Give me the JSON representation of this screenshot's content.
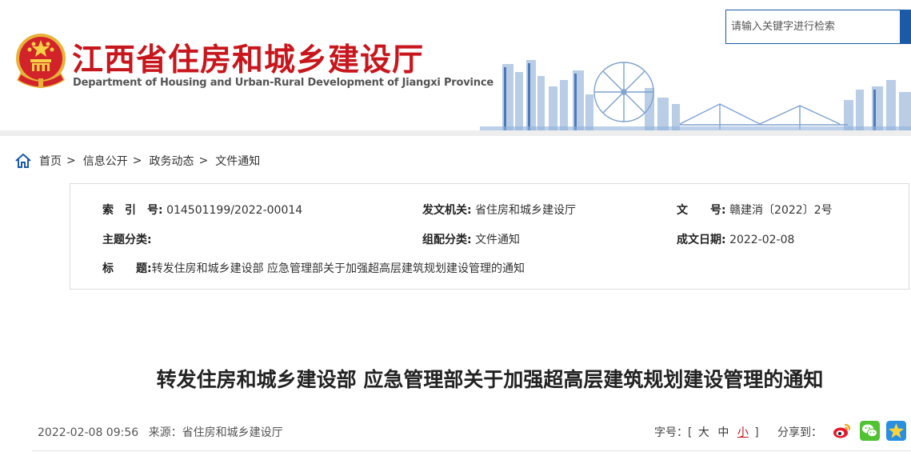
{
  "header": {
    "site_title": "江西省住房和城乡建设厅",
    "site_subtitle": "Department of Housing and Urban-Rural Development of Jiangxi Province",
    "search_placeholder": "请输入关键字进行检索",
    "accent_color": "#c8161d",
    "search_color": "#1a5aa8",
    "emblem_icon": "national-emblem-icon",
    "search_icon": "search-icon"
  },
  "breadcrumb": {
    "home_icon": "home-icon",
    "items": [
      "首页",
      "信息公开",
      "政务动态",
      "文件通知"
    ],
    "separator": ">"
  },
  "meta": {
    "index": {
      "label": "索　引　号:",
      "value": "014501199/2022-00014"
    },
    "issuer": {
      "label": "发文机关:",
      "value": "省住房和城乡建设厅"
    },
    "doc_no": {
      "label": "文　　号:",
      "value": "赣建消〔2022〕2号"
    },
    "topic": {
      "label": "主题分类:",
      "value": ""
    },
    "category": {
      "label": "组配分类:",
      "value": "文件通知"
    },
    "date": {
      "label": "成文日期:",
      "value": "2022-02-08"
    },
    "title": {
      "label": "标　　题:",
      "value": "转发住房和城乡建设部 应急管理部关于加强超高层建筑规划建设管理的通知"
    }
  },
  "article": {
    "title": "转发住房和城乡建设部 应急管理部关于加强超高层建筑规划建设管理的通知",
    "datetime": "2022-02-08 09:56",
    "source_label": "来源：",
    "source": "省住房和城乡建设厅"
  },
  "tools": {
    "font_size_label": "字号：[",
    "font_large": "大",
    "font_medium": "中",
    "font_small": "小",
    "font_close": "]",
    "share_label": "分享到：",
    "share_icons": [
      "weibo-icon",
      "wechat-icon",
      "qzone-icon"
    ]
  }
}
